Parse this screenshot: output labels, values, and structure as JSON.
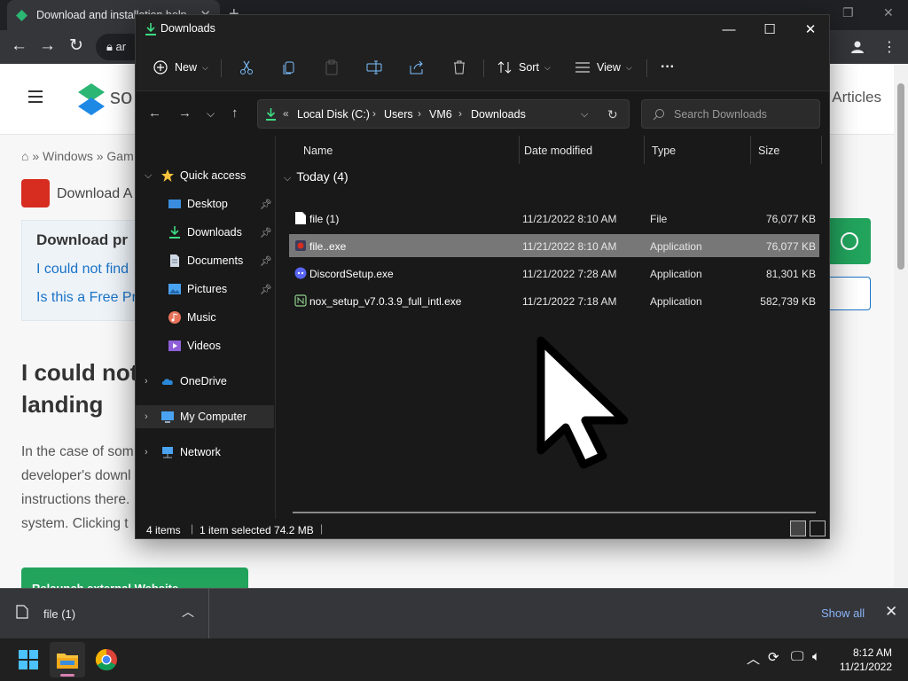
{
  "browser": {
    "tab_title": "Download and installation help",
    "omnibox_text": "ar",
    "site_name": "so",
    "nav_right": "Articles",
    "breadcrumb": "» Windows » Gam",
    "download_title": "Download A",
    "notice": {
      "title": "Download pr",
      "link1": "I could not find",
      "link2": "Is this a Free Pr"
    },
    "heading": [
      "I could not",
      "landing"
    ],
    "body_lines": [
      "In the case of som",
      "developer's downl",
      "instructions there.",
      "system. Clicking t"
    ],
    "relaunch_button": "Relaunch external Website",
    "accent_green": "#22a45d",
    "link_blue": "#1a73c8"
  },
  "download_shelf": {
    "file_name": "file (1)",
    "show_all": "Show all"
  },
  "taskbar": {
    "time": "8:12 AM",
    "date": "11/21/2022",
    "apps": [
      "start-icon",
      "file-explorer-icon",
      "chrome-icon"
    ]
  },
  "explorer": {
    "title": "Downloads",
    "commands": {
      "new": "New",
      "sort": "Sort",
      "view": "View",
      "more": "···"
    },
    "path": {
      "overflow": "«",
      "segments": [
        "Local Disk (C:)",
        "Users",
        "VM6",
        "Downloads"
      ]
    },
    "search_placeholder": "Search Downloads",
    "nav": {
      "quick_access": "Quick access",
      "pinned": [
        "Desktop",
        "Downloads",
        "Documents",
        "Pictures"
      ],
      "other": [
        "Music",
        "Videos"
      ],
      "onedrive": "OneDrive",
      "my_computer": "My Computer",
      "network": "Network"
    },
    "columns": {
      "name": "Name",
      "date": "Date modified",
      "type": "Type",
      "size": "Size"
    },
    "group": "Today (4)",
    "files": [
      {
        "name": "file (1)",
        "date": "11/21/2022 8:10 AM",
        "type": "File",
        "size": "76,077 KB",
        "icon": "blank-file-icon",
        "selected": false
      },
      {
        "name": "file..exe",
        "date": "11/21/2022 8:10 AM",
        "type": "Application",
        "size": "76,077 KB",
        "icon": "exe-app-icon",
        "selected": true
      },
      {
        "name": "DiscordSetup.exe",
        "date": "11/21/2022 7:28 AM",
        "type": "Application",
        "size": "81,301 KB",
        "icon": "discord-icon",
        "selected": false
      },
      {
        "name": "nox_setup_v7.0.3.9_full_intl.exe",
        "date": "11/21/2022 7:18 AM",
        "type": "Application",
        "size": "582,739 KB",
        "icon": "nox-installer-icon",
        "selected": false
      }
    ],
    "status": {
      "items": "4 items",
      "selected": "1 item selected  74.2 MB"
    }
  }
}
